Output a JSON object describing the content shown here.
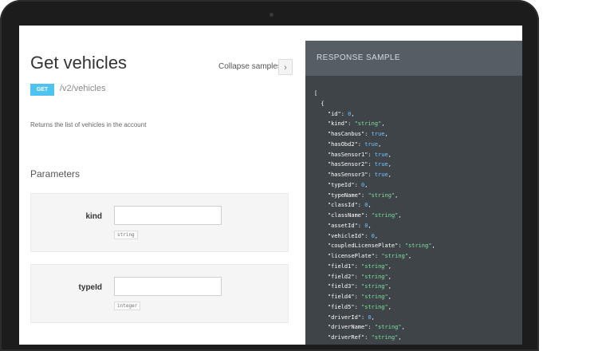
{
  "page": {
    "title": "Get vehicles",
    "collapse_label": "Collapse samples",
    "collapse_icon": "chevron-right-icon",
    "method": "GET",
    "path": "/v2/vehicles",
    "description": "Returns the list of vehicles in the account",
    "params_heading": "Parameters"
  },
  "params": [
    {
      "name": "kind",
      "type": "string",
      "value": ""
    },
    {
      "name": "typeId",
      "type": "integer",
      "value": ""
    }
  ],
  "response": {
    "heading": "RESPONSE SAMPLE",
    "open": [
      "[",
      "  {"
    ],
    "fields": [
      {
        "key": "\"id\"",
        "value": "0",
        "kind": "n"
      },
      {
        "key": "\"kind\"",
        "value": "\"string\"",
        "kind": "s"
      },
      {
        "key": "\"hasCanbus\"",
        "value": "true",
        "kind": "b"
      },
      {
        "key": "\"hasObd2\"",
        "value": "true",
        "kind": "b"
      },
      {
        "key": "\"hasSensor1\"",
        "value": "true",
        "kind": "b"
      },
      {
        "key": "\"hasSensor2\"",
        "value": "true",
        "kind": "b"
      },
      {
        "key": "\"hasSensor3\"",
        "value": "true",
        "kind": "b"
      },
      {
        "key": "\"typeId\"",
        "value": "0",
        "kind": "n"
      },
      {
        "key": "\"typeName\"",
        "value": "\"string\"",
        "kind": "s"
      },
      {
        "key": "\"classId\"",
        "value": "0",
        "kind": "n"
      },
      {
        "key": "\"className\"",
        "value": "\"string\"",
        "kind": "s"
      },
      {
        "key": "\"assetId\"",
        "value": "0",
        "kind": "n"
      },
      {
        "key": "\"vehicleId\"",
        "value": "0",
        "kind": "n"
      },
      {
        "key": "\"coupledLicensePlate\"",
        "value": "\"string\"",
        "kind": "s"
      },
      {
        "key": "\"licensePlate\"",
        "value": "\"string\"",
        "kind": "s"
      },
      {
        "key": "\"field1\"",
        "value": "\"string\"",
        "kind": "s"
      },
      {
        "key": "\"field2\"",
        "value": "\"string\"",
        "kind": "s"
      },
      {
        "key": "\"field3\"",
        "value": "\"string\"",
        "kind": "s"
      },
      {
        "key": "\"field4\"",
        "value": "\"string\"",
        "kind": "s"
      },
      {
        "key": "\"field5\"",
        "value": "\"string\"",
        "kind": "s"
      },
      {
        "key": "\"driverId\"",
        "value": "0",
        "kind": "n"
      },
      {
        "key": "\"driverName\"",
        "value": "\"string\"",
        "kind": "s"
      },
      {
        "key": "\"driverRef\"",
        "value": "\"string\"",
        "kind": "s"
      }
    ]
  }
}
